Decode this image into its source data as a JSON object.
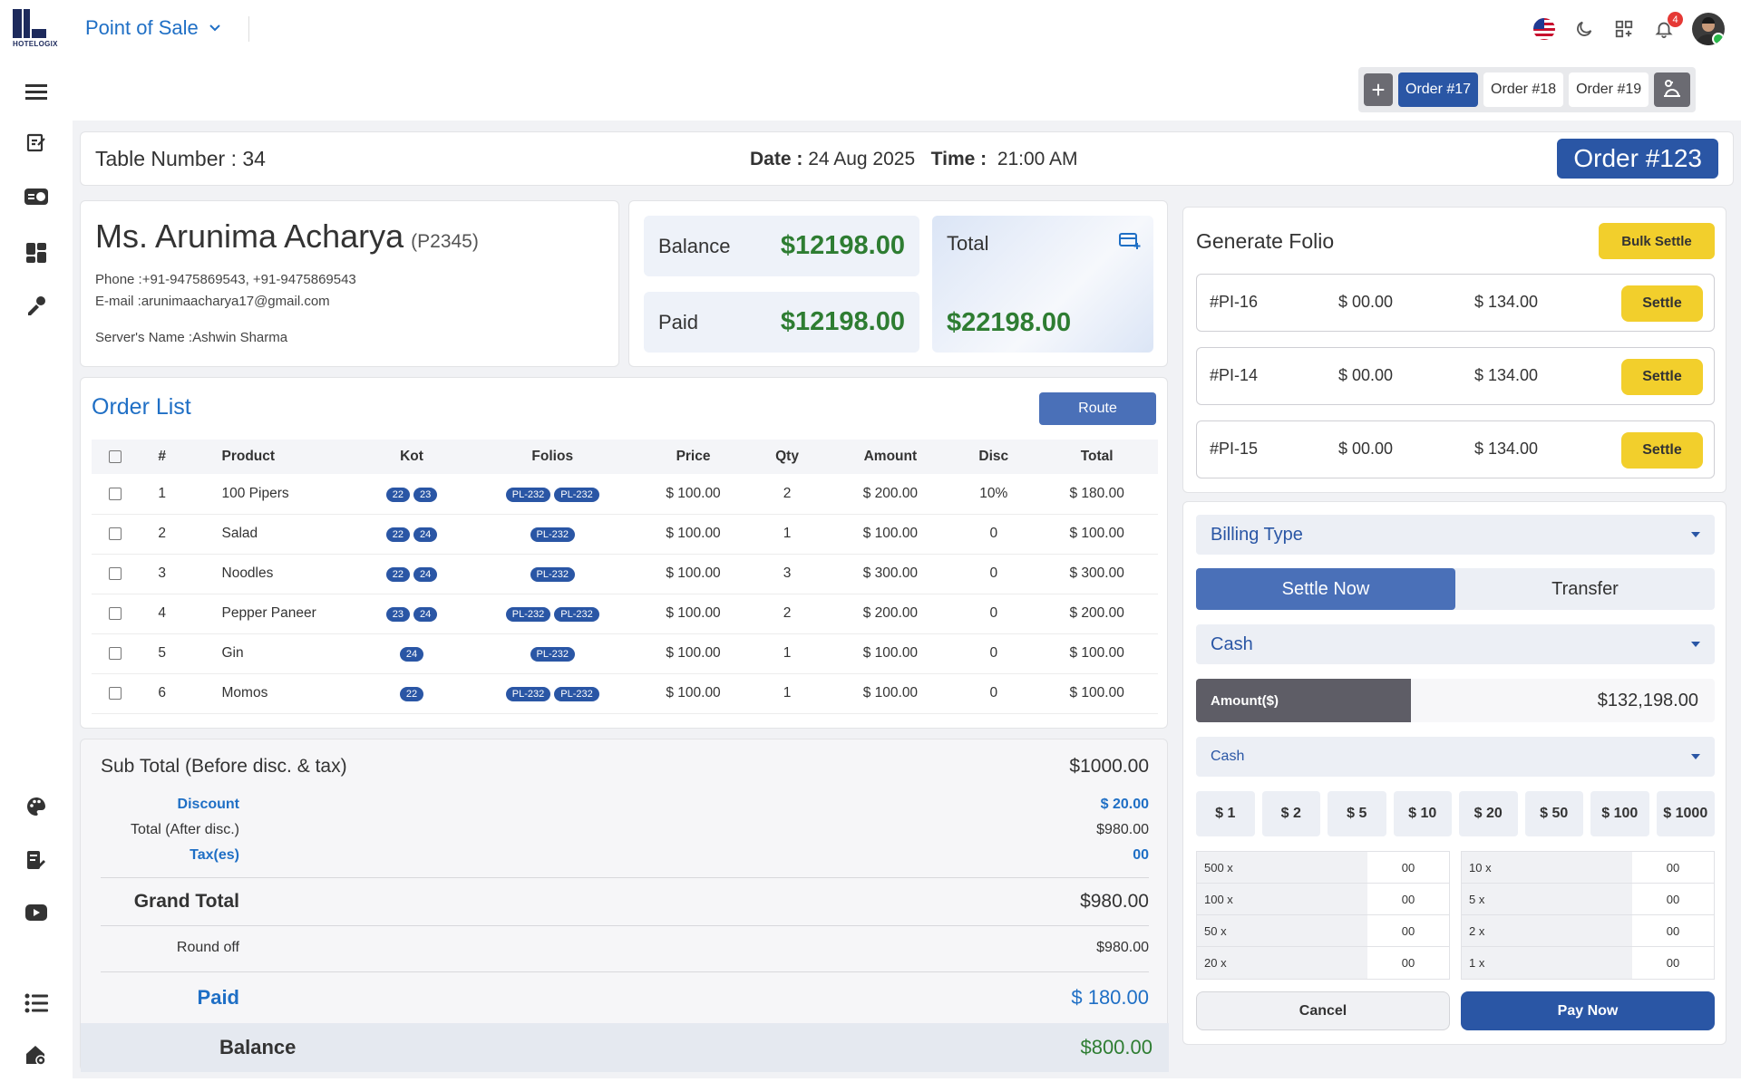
{
  "app": {
    "brand": "HOTELOGIX",
    "module": "Point of Sale",
    "notif_count": "4"
  },
  "tabs": {
    "items": [
      "Order #17",
      "Order #18",
      "Order #19"
    ],
    "active": 0
  },
  "header": {
    "table_label": "Table Number :",
    "table_value": "34",
    "date_label": "Date :",
    "date_value": "24 Aug 2025",
    "time_label": "Time :",
    "time_value": "21:00 AM",
    "order": "Order #123"
  },
  "guest": {
    "name": "Ms. Arunima Acharya",
    "code": "(P2345)",
    "phone_label": "Phone :",
    "phone": "+91-9475869543, +91-9475869543",
    "email_label": "E-mail :",
    "email": "arunimaacharya17@gmail.com",
    "server_label": "Server's Name :",
    "server": "Ashwin Sharma"
  },
  "summary": {
    "balance_label": "Balance",
    "balance": "$12198.00",
    "paid_label": "Paid",
    "paid": "$12198.00",
    "total_label": "Total",
    "total": "$22198.00"
  },
  "order_list": {
    "title": "Order List",
    "route_label": "Route",
    "columns": [
      "#",
      "Product",
      "Kot",
      "Folios",
      "Price",
      "Qty",
      "Amount",
      "Disc",
      "Total"
    ],
    "rows": [
      {
        "no": "1",
        "product": "100 Pipers",
        "kot": [
          "22",
          "23"
        ],
        "folios": [
          "PL-232",
          "PL-232"
        ],
        "price": "$ 100.00",
        "qty": "2",
        "amount": "$ 200.00",
        "disc": "10%",
        "total": "$ 180.00"
      },
      {
        "no": "2",
        "product": "Salad",
        "kot": [
          "22",
          "24"
        ],
        "folios": [
          "PL-232"
        ],
        "price": "$ 100.00",
        "qty": "1",
        "amount": "$ 100.00",
        "disc": "0",
        "total": "$ 100.00"
      },
      {
        "no": "3",
        "product": "Noodles",
        "kot": [
          "22",
          "24"
        ],
        "folios": [
          "PL-232"
        ],
        "price": "$ 100.00",
        "qty": "3",
        "amount": "$ 300.00",
        "disc": "0",
        "total": "$ 300.00"
      },
      {
        "no": "4",
        "product": "Pepper Paneer",
        "kot": [
          "23",
          "24"
        ],
        "folios": [
          "PL-232",
          "PL-232"
        ],
        "price": "$ 100.00",
        "qty": "2",
        "amount": "$ 200.00",
        "disc": "0",
        "total": "$ 200.00"
      },
      {
        "no": "5",
        "product": "Gin",
        "kot": [
          "24"
        ],
        "folios": [
          "PL-232"
        ],
        "price": "$ 100.00",
        "qty": "1",
        "amount": "$ 100.00",
        "disc": "0",
        "total": "$ 100.00"
      },
      {
        "no": "6",
        "product": "Momos",
        "kot": [
          "22"
        ],
        "folios": [
          "PL-232",
          "PL-232"
        ],
        "price": "$ 100.00",
        "qty": "1",
        "amount": "$ 100.00",
        "disc": "0",
        "total": "$ 100.00"
      }
    ]
  },
  "totals": {
    "subtotal_label": "Sub Total (Before disc. & tax)",
    "subtotal": "$1000.00",
    "discount_label": "Discount",
    "discount": "$ 20.00",
    "after_disc_label": "Total (After disc.)",
    "after_disc": "$980.00",
    "tax_label": "Tax(es)",
    "tax": "00",
    "grand_label": "Grand Total",
    "grand": "$980.00",
    "roundoff_label": "Round off",
    "roundoff": "$980.00",
    "paid_label": "Paid",
    "paid": "$ 180.00",
    "balance_label": "Balance",
    "balance": "$800.00"
  },
  "folio": {
    "title": "Generate Folio",
    "bulk_label": "Bulk Settle",
    "settle_label": "Settle",
    "rows": [
      {
        "id": "#PI-16",
        "paid": "$ 00.00",
        "due": "$ 134.00"
      },
      {
        "id": "#PI-14",
        "paid": "$ 00.00",
        "due": "$ 134.00"
      },
      {
        "id": "#PI-15",
        "paid": "$ 00.00",
        "due": "$ 134.00"
      }
    ]
  },
  "payment": {
    "billing_type": "Billing Type",
    "settle_now": "Settle Now",
    "transfer": "Transfer",
    "method": "Cash",
    "amount_label": "Amount($)",
    "amount": "$132,198.00",
    "method2": "Cash",
    "denoms": [
      "$ 1",
      "$ 2",
      "$ 5",
      "$ 10",
      "$ 20",
      "$ 50",
      "$ 100",
      "$ 1000"
    ],
    "counts_left": [
      {
        "k": "500 x",
        "v": "00"
      },
      {
        "k": "100 x",
        "v": "00"
      },
      {
        "k": "50 x",
        "v": "00"
      },
      {
        "k": "20 x",
        "v": "00"
      }
    ],
    "counts_right": [
      {
        "k": "10 x",
        "v": "00"
      },
      {
        "k": "5 x",
        "v": "00"
      },
      {
        "k": "2 x",
        "v": "00"
      },
      {
        "k": "1 x",
        "v": "00"
      }
    ],
    "cancel": "Cancel",
    "pay_now": "Pay Now"
  },
  "colors": {
    "primary": "#2a56a5",
    "accent": "#f2cf2c",
    "money": "#2e7d32",
    "link": "#1f6fc5"
  }
}
